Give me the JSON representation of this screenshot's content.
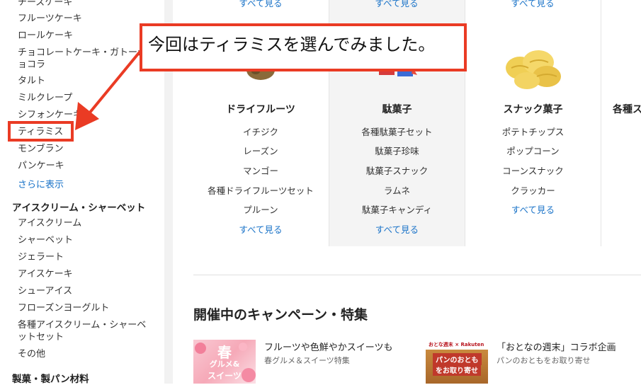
{
  "sidebar": {
    "cake_items": [
      "チーズケーキ",
      "フルーツケーキ",
      "ロールケーキ",
      "チョコレートケーキ・ガトーショコラ",
      "タルト",
      "ミルクレープ",
      "シフォンケーキ",
      "ティラミス",
      "モンブラン",
      "パンケーキ"
    ],
    "show_more": "さらに表示",
    "ice_heading": "アイスクリーム・シャーベット",
    "ice_items": [
      "アイスクリーム",
      "シャーベット",
      "ジェラート",
      "アイスケーキ",
      "シューアイス",
      "フローズンヨーグルト",
      "各種アイスクリーム・シャーベットセット",
      "その他"
    ],
    "baking_heading": "製菓・製パン材料"
  },
  "top_links": [
    "すべて見る",
    "すべて見る",
    "すべて見る"
  ],
  "columns": [
    {
      "title": "ドライフルーツ",
      "items": [
        "イチジク",
        "レーズン",
        "マンゴー",
        "各種ドライフルーツセット",
        "プルーン"
      ],
      "more": "すべて見る"
    },
    {
      "title": "駄菓子",
      "items": [
        "各種駄菓子セット",
        "駄菓子珍味",
        "駄菓子スナック",
        "ラムネ",
        "駄菓子キャンディ"
      ],
      "more": "すべて見る"
    },
    {
      "title": "スナック菓子",
      "items": [
        "ポテトチップス",
        "ポップコーン",
        "コーンスナック",
        "クラッカー"
      ],
      "more": "すべて見る"
    },
    {
      "title": "各種ス"
    }
  ],
  "campaign": {
    "heading": "開催中のキャンペーン・特集",
    "cards": [
      {
        "title": "フルーツや色鮮やかスイーツも",
        "subtitle": "春グルメ＆スイーツ特集",
        "thumb_text": [
          "春",
          "グルメ&",
          "スイーツ"
        ]
      },
      {
        "title": "「おとなの週末」コラボ企画",
        "subtitle": "パンのおともをお取り寄せ",
        "thumb_text": [
          "おとな週末 × Rakuten",
          "パンのおとも",
          "をお取り寄せ"
        ]
      }
    ]
  },
  "annotation": {
    "text": "今回はティラミスを選んでみました。",
    "color": "#ea3b24"
  },
  "colors": {
    "link": "#1a73c8",
    "accent": "#ea3b24"
  }
}
